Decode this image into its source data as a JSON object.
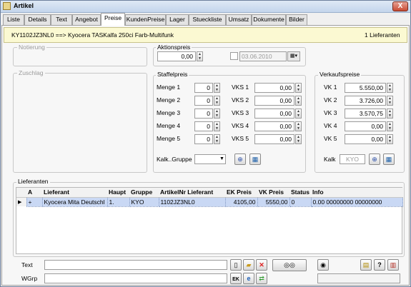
{
  "window": {
    "title": "Artikel",
    "close": "X"
  },
  "tabs": [
    "Liste",
    "Details",
    "Text",
    "Angebot",
    "Preise",
    "KundenPreise",
    "Lager",
    "Stueckliste",
    "Umsatz",
    "Dokumente",
    "Bilder"
  ],
  "header": {
    "article": "KY1102JZ3NL0 ==> Kyocera TASKalfa 250ci Farb-Multifunk",
    "suppliers_count": "1 Lieferanten"
  },
  "notierung": {
    "title": "Notierung"
  },
  "zuschlag": {
    "title": "Zuschlag"
  },
  "aktionspreis": {
    "title": "Aktionspreis",
    "value": "0,00",
    "date": "03.06.2010"
  },
  "staffelpreis": {
    "title": "Staffelpreis",
    "rows": [
      {
        "menge_label": "Menge 1",
        "menge": "0",
        "vks_label": "VKS 1",
        "vks": "0,00"
      },
      {
        "menge_label": "Menge 2",
        "menge": "0",
        "vks_label": "VKS 2",
        "vks": "0,00"
      },
      {
        "menge_label": "Menge 3",
        "menge": "0",
        "vks_label": "VKS 3",
        "vks": "0,00"
      },
      {
        "menge_label": "Menge 4",
        "menge": "0",
        "vks_label": "VKS 4",
        "vks": "0,00"
      },
      {
        "menge_label": "Menge 5",
        "menge": "0",
        "vks_label": "VKS 5",
        "vks": "0,00"
      }
    ],
    "kalk_gruppe_label": "Kalk..Gruppe",
    "kalk_gruppe_value": ""
  },
  "verkaufspreise": {
    "title": "Verkaufspreise",
    "rows": [
      {
        "label": "VK 1",
        "value": "5.550,00"
      },
      {
        "label": "VK 2",
        "value": "3.726,00"
      },
      {
        "label": "VK 3",
        "value": "3.570,75"
      },
      {
        "label": "VK 4",
        "value": "0,00"
      },
      {
        "label": "VK 5",
        "value": "0,00"
      }
    ],
    "kalk_label": "Kalk",
    "kalk_value": "KYO"
  },
  "lieferanten": {
    "title": "Lieferanten",
    "columns": [
      "A",
      "Lieferant",
      "Haupt",
      "Gruppe",
      "ArtikelNr Lieferant",
      "EK Preis",
      "VK Preis",
      "Status",
      "Info"
    ],
    "rows": [
      {
        "marker": "▶",
        "a": "+",
        "lieferant": "Kyocera Mita Deutschl",
        "haupt": "1.",
        "gruppe": "KYO",
        "artikelnr": "1102JZ3NL0",
        "ek": "4105,00",
        "vk": "5550,00",
        "status": "0",
        "info": "0.00 00000000 00000000"
      }
    ]
  },
  "bottom": {
    "text_label": "Text",
    "wgrp_label": "WGrp"
  },
  "icons": [
    "calendar-icon",
    "magnifier-icon",
    "calculator-icon",
    "new-document-icon",
    "open-folder-icon",
    "delete-icon",
    "binoculars-icon",
    "note-icon",
    "help-icon",
    "export-icon",
    "search-web-icon",
    "refresh-icon"
  ]
}
